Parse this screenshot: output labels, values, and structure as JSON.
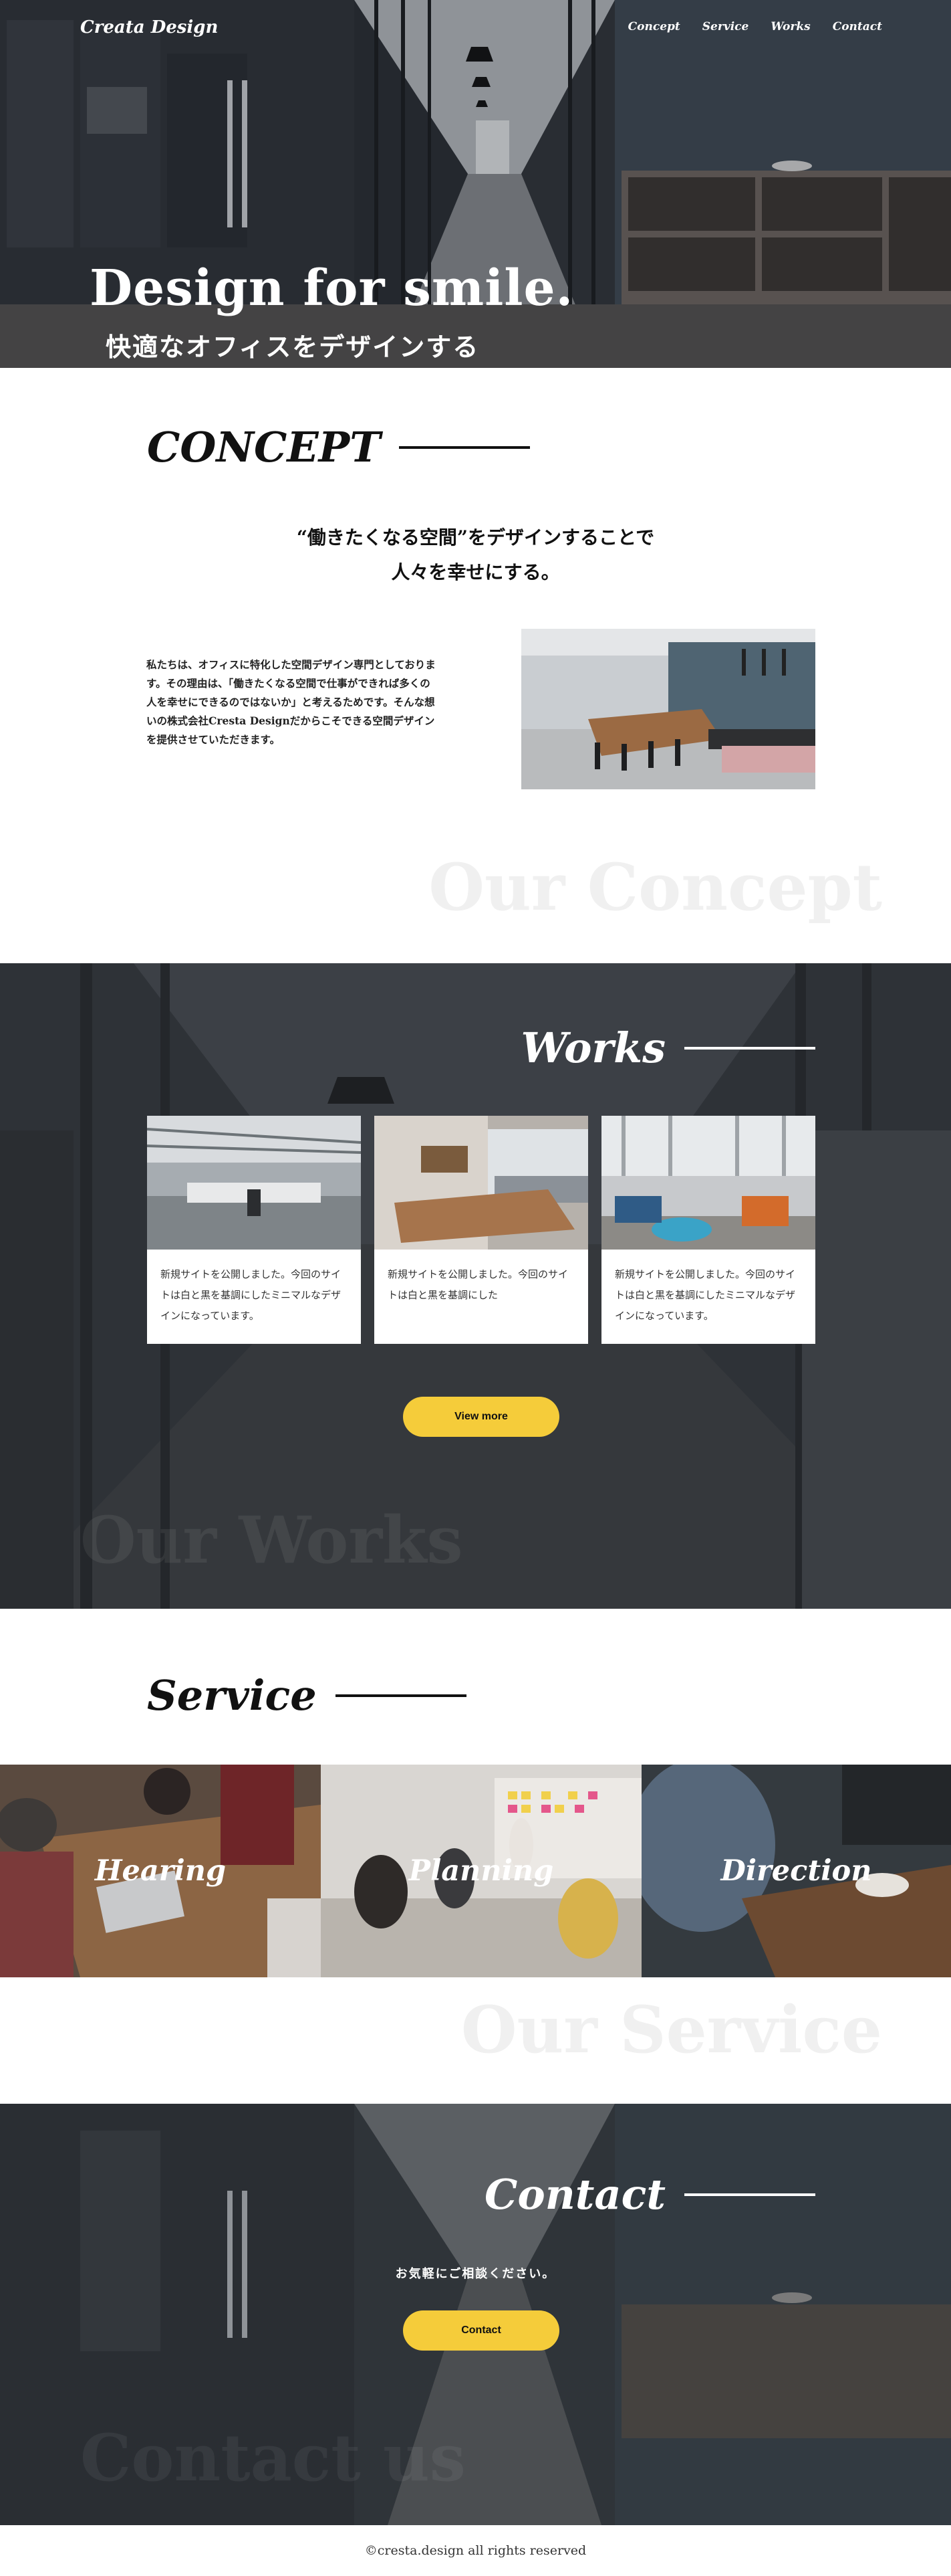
{
  "header": {
    "logo": "Creata Design",
    "nav": [
      "Concept",
      "Service",
      "Works",
      "Contact"
    ]
  },
  "hero": {
    "title": "Design for smile.",
    "subtitle": "快適なオフィスをデザインする"
  },
  "concept": {
    "heading": "CONCEPT",
    "lead_line1": "“働きたくなる空間”をデザインすることで",
    "lead_line2": "人々を幸せにする。",
    "body": "私たちは、オフィスに特化した空間デザイン専門としております。その理由は、「働きたくなる空間で仕事ができれば多くの人を幸せにできるのではないか」と考えるためです。そんな想いの株式会社Cresta Designだからこそできる空間デザインを提供させていただきます。",
    "ghost": "Our Concept"
  },
  "works": {
    "heading": "Works",
    "cards": [
      "新規サイトを公開しました。今回のサイトは白と黒を基調にしたミニマルなデザインになっています。",
      "新規サイトを公開しました。今回のサイトは白と黒を基調にした",
      "新規サイトを公開しました。今回のサイトは白と黒を基調にしたミニマルなデザインになっています。"
    ],
    "button": "View more",
    "ghost": "Our Works"
  },
  "service": {
    "heading": "Service",
    "items": [
      "Hearing",
      "Planning",
      "Direction"
    ],
    "ghost": "Our Service"
  },
  "contact": {
    "heading": "Contact",
    "message": "お気軽にご相談ください。",
    "button": "Contact",
    "ghost": "Contact us"
  },
  "footer": {
    "copyright": "©cresta.design all rights reserved"
  },
  "colors": {
    "accent": "#f5cc3a",
    "dark": "#2d3238",
    "text": "#111111"
  }
}
